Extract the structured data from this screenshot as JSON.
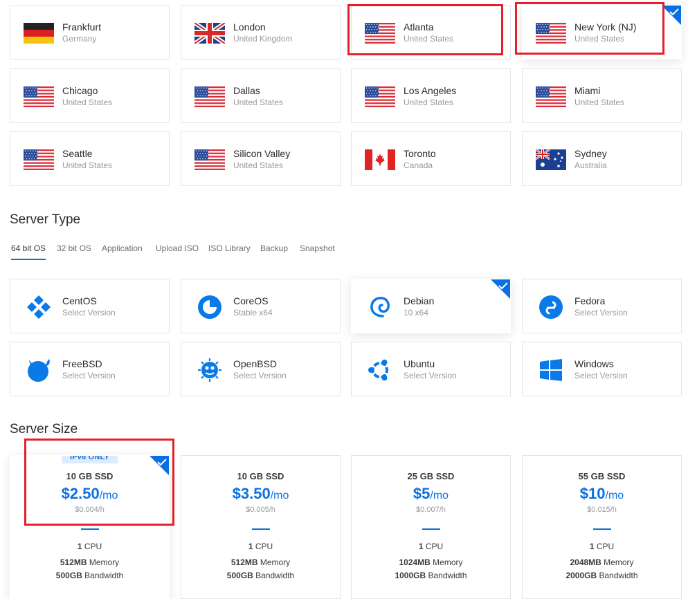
{
  "locations": [
    {
      "city": "Frankfurt",
      "country": "Germany",
      "flag": "de"
    },
    {
      "city": "London",
      "country": "United Kingdom",
      "flag": "uk"
    },
    {
      "city": "Atlanta",
      "country": "United States",
      "flag": "us"
    },
    {
      "city": "New York (NJ)",
      "country": "United States",
      "flag": "us",
      "selected": true
    },
    {
      "city": "Chicago",
      "country": "United States",
      "flag": "us"
    },
    {
      "city": "Dallas",
      "country": "United States",
      "flag": "us"
    },
    {
      "city": "Los Angeles",
      "country": "United States",
      "flag": "us"
    },
    {
      "city": "Miami",
      "country": "United States",
      "flag": "us"
    },
    {
      "city": "Seattle",
      "country": "United States",
      "flag": "us"
    },
    {
      "city": "Silicon Valley",
      "country": "United States",
      "flag": "us"
    },
    {
      "city": "Toronto",
      "country": "Canada",
      "flag": "ca"
    },
    {
      "city": "Sydney",
      "country": "Australia",
      "flag": "au"
    }
  ],
  "server_type": {
    "title": "Server Type",
    "tabs": [
      "64 bit OS",
      "32 bit OS",
      "Application",
      "Upload ISO",
      "ISO Library",
      "Backup",
      "Snapshot"
    ],
    "active_tab": "64 bit OS",
    "os": [
      {
        "name": "CentOS",
        "sub": "Select Version",
        "icon": "centos-icon"
      },
      {
        "name": "CoreOS",
        "sub": "Stable  x64",
        "icon": "coreos-icon"
      },
      {
        "name": "Debian",
        "sub": "10  x64",
        "icon": "debian-icon",
        "selected": true
      },
      {
        "name": "Fedora",
        "sub": "Select Version",
        "icon": "fedora-icon"
      },
      {
        "name": "FreeBSD",
        "sub": "Select Version",
        "icon": "freebsd-icon"
      },
      {
        "name": "OpenBSD",
        "sub": "Select Version",
        "icon": "openbsd-icon"
      },
      {
        "name": "Ubuntu",
        "sub": "Select Version",
        "icon": "ubuntu-icon"
      },
      {
        "name": "Windows",
        "sub": "Select Version",
        "icon": "windows-icon"
      }
    ]
  },
  "server_size": {
    "title": "Server Size",
    "plans": [
      {
        "badge": "IPv6 ONLY",
        "ssd": "10 GB SSD",
        "price": "$2.50",
        "per": "/mo",
        "hourly": "$0.004/h",
        "cpu_num": "1",
        "cpu_label": " CPU",
        "mem_num": "512MB",
        "mem_label": " Memory",
        "bw_num": "500GB",
        "bw_label": " Bandwidth",
        "selected": true
      },
      {
        "ssd": "10 GB SSD",
        "price": "$3.50",
        "per": "/mo",
        "hourly": "$0.005/h",
        "cpu_num": "1",
        "cpu_label": " CPU",
        "mem_num": "512MB",
        "mem_label": " Memory",
        "bw_num": "500GB",
        "bw_label": " Bandwidth"
      },
      {
        "ssd": "25 GB SSD",
        "price": "$5",
        "per": "/mo",
        "hourly": "$0.007/h",
        "cpu_num": "1",
        "cpu_label": " CPU",
        "mem_num": "1024MB",
        "mem_label": " Memory",
        "bw_num": "1000GB",
        "bw_label": " Bandwidth"
      },
      {
        "ssd": "55 GB SSD",
        "price": "$10",
        "per": "/mo",
        "hourly": "$0.015/h",
        "cpu_num": "1",
        "cpu_label": " CPU",
        "mem_num": "2048MB",
        "mem_label": " Memory",
        "bw_num": "2000GB",
        "bw_label": " Bandwidth"
      }
    ]
  },
  "colors": {
    "accent": "#0a6fe1",
    "highlight": "#e4202a",
    "os_icon": "#0a7ae8"
  }
}
